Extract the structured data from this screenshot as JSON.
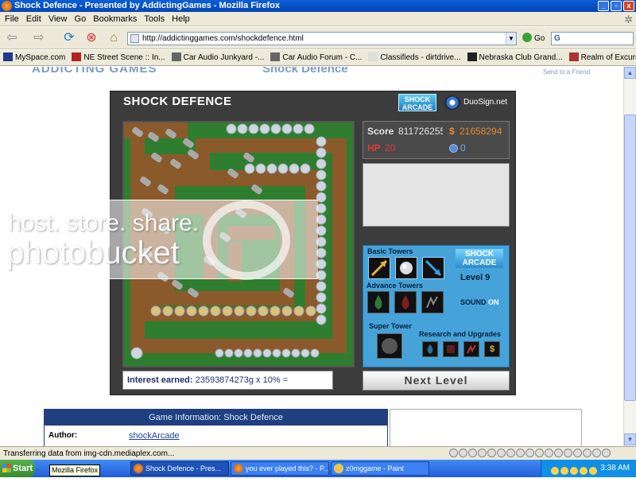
{
  "window": {
    "title": "Shock Defence - Presented by AddictingGames - Mozilla Firefox",
    "controls": [
      "_",
      "▫",
      "x"
    ]
  },
  "menu": [
    "File",
    "Edit",
    "View",
    "Go",
    "Bookmarks",
    "Tools",
    "Help"
  ],
  "nav": {
    "url": "http://addictinggames.com/shockdefence.html",
    "go_label": "Go",
    "search_value": "G"
  },
  "bookmarks": [
    {
      "label": "MySpace.com",
      "icon": "myspace-icon",
      "color": "#1b3b8f"
    },
    {
      "label": "NE Street Scene :: In...",
      "icon": "street-scene-icon",
      "color": "#b22222"
    },
    {
      "label": "Car Audio Junkyard -...",
      "icon": "car-audio-icon",
      "color": "#666666"
    },
    {
      "label": "Car Audio Forum - C...",
      "icon": "forum-icon",
      "color": "#666666"
    },
    {
      "label": "Classifieds - dirtdrive...",
      "icon": "page-icon",
      "color": "#dddddd"
    },
    {
      "label": "Nebraska Club Grand...",
      "icon": "club-icon",
      "color": "#222222"
    },
    {
      "label": "Realm of Excursion",
      "icon": "realm-icon",
      "color": "#a33"
    }
  ],
  "site": {
    "logo": "ADDICTING GAMES",
    "heading": "Shock Defence",
    "send_to_friend": "Send to a Friend"
  },
  "game": {
    "title": "SHOCK DEFENCE",
    "shock_logo": "SHOCK ARCADE",
    "duosign": "DuoSign.net",
    "score_label": "Score",
    "score_value": "811726255",
    "money_symbol": "$",
    "money_value": "21658294",
    "hp_label": "HP",
    "hp_value": "20",
    "orbs_value": "0",
    "basic_towers": "Basic Towers",
    "advance_towers": "Advance Towers",
    "super_tower": "Super Tower",
    "research": "Research and Upgrades",
    "panel_logo": "SHOCK ARCADE",
    "level": "Level 9",
    "sound_label": "SOUND",
    "sound_state": "ON",
    "interest_label": "Interest earned:",
    "interest_value": "23593874273g x 10% =",
    "next_level": "Next  Level",
    "colors": {
      "accent": "#45a3da",
      "frame": "#3c3c3c",
      "score": "#e3e3e3",
      "money": "#e08a2a",
      "hp": "#e23b3b"
    }
  },
  "watermark": {
    "line1": "host. store. share.",
    "line2": "photobucket"
  },
  "game_info": {
    "heading": "Game Information: Shock Defence",
    "author_label": "Author:",
    "author_value": "shockArcade"
  },
  "status": {
    "text": "Transferring data from img-cdn.mediaplex.com..."
  },
  "taskbar": {
    "start": "Start",
    "tooltip": "Mozilla Firefox",
    "items": [
      {
        "label": "Shock Defence - Pres..."
      },
      {
        "label": "you ever played this? - P..."
      },
      {
        "label": "z0mggame - Paint"
      }
    ],
    "clock": "3:38 AM"
  }
}
